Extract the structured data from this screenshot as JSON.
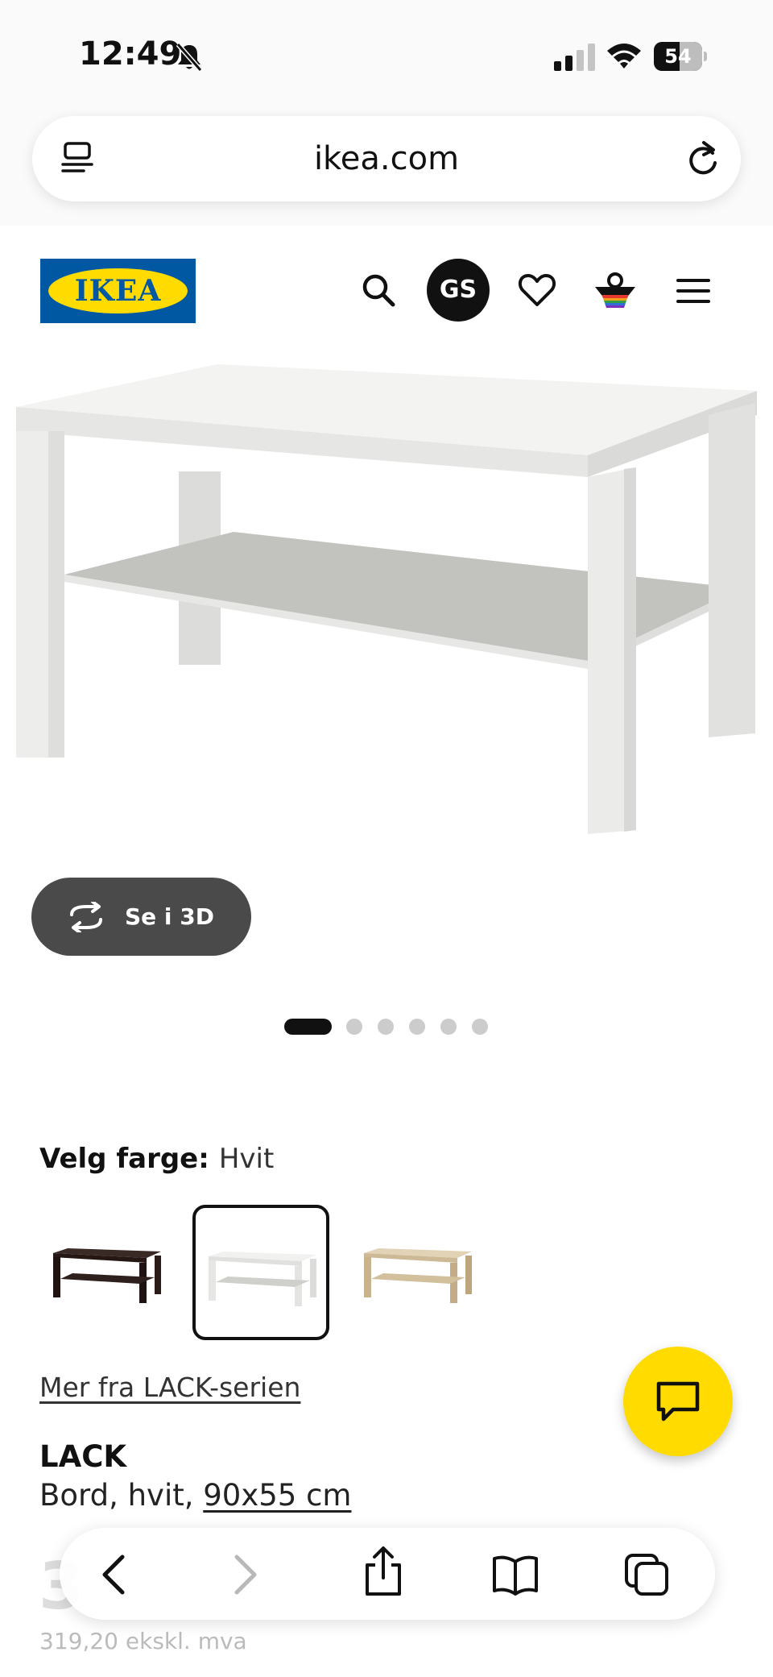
{
  "status_bar": {
    "time": "12:49",
    "battery": "54",
    "battery_level": 0.54
  },
  "browser": {
    "url": "ikea.com"
  },
  "header": {
    "logo_text": "IKEA",
    "avatar_initials": "GS"
  },
  "product_media": {
    "see_3d_label": "Se i 3D",
    "slide_count": 6,
    "active_slide": 1
  },
  "color_choice": {
    "label": "Velg farge:",
    "selected": "Hvit",
    "swatches": [
      {
        "name": "black-brown",
        "color": "#2b1d1a",
        "selected": false
      },
      {
        "name": "white",
        "color": "#f4f4f2",
        "selected": true
      },
      {
        "name": "white-stained-oak",
        "color": "#d9c6a6",
        "selected": false
      }
    ]
  },
  "series_link": "Mer fra LACK-serien",
  "product": {
    "name": "LACK",
    "desc_prefix": "Bord, hvit, ",
    "size": "90x55 cm",
    "price_partial": "3",
    "price_excl": "319,20 ekskl. mva"
  },
  "colors": {
    "ikea_blue": "#0058a3",
    "ikea_yellow": "#ffdb00",
    "chat_fab": "#ffdb00",
    "pill_bg": "#4a4a4a"
  },
  "toolbar": {
    "icons": [
      "back-icon",
      "forward-icon",
      "share-icon",
      "bookmarks-icon",
      "tabs-icon"
    ]
  }
}
